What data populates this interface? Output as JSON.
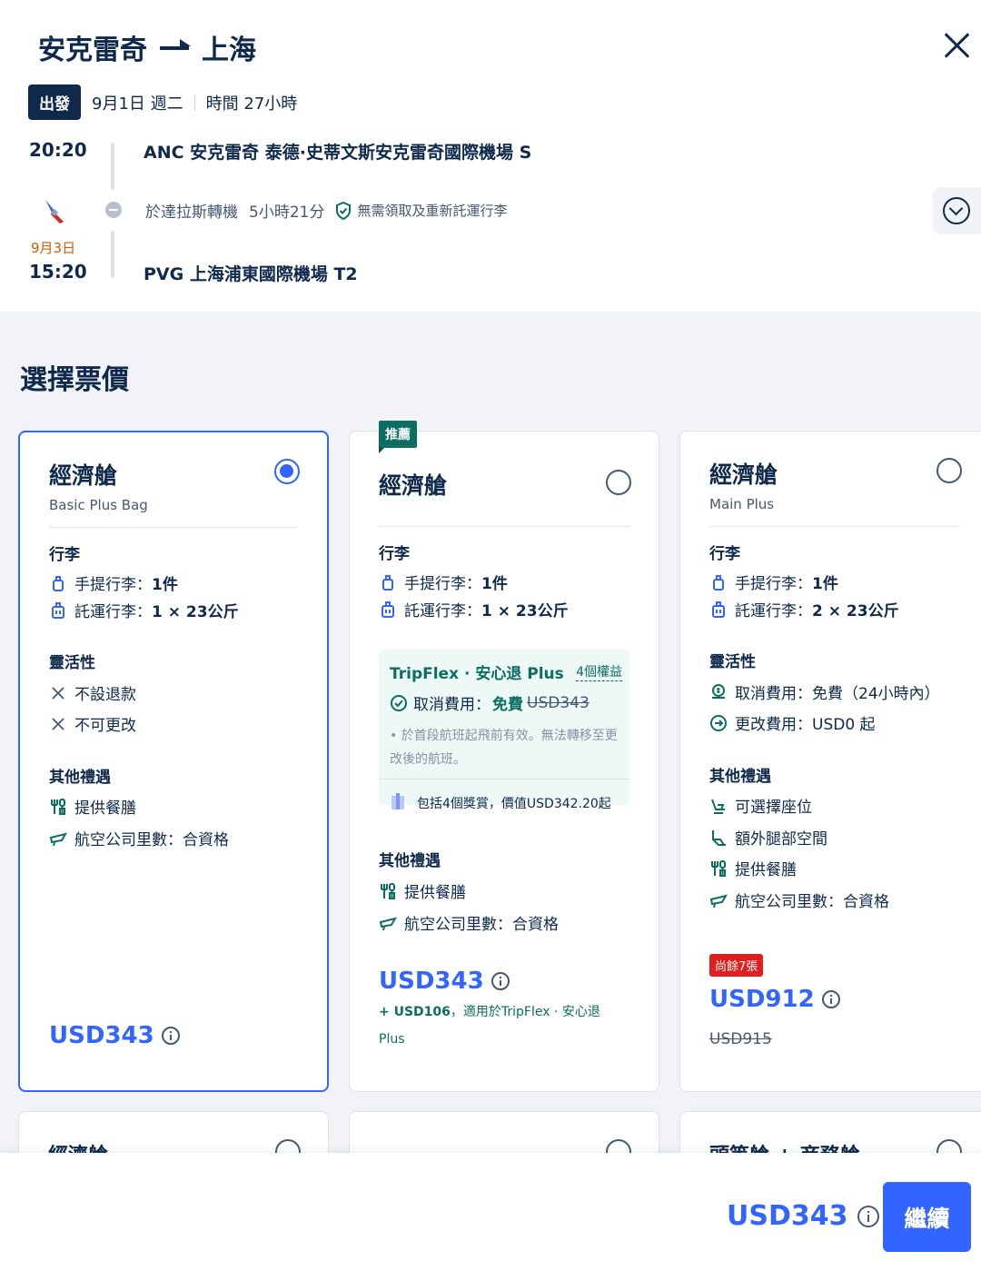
{
  "header": {
    "origin": "安克雷奇",
    "destination": "上海",
    "departure_badge": "出發",
    "date": "9月1日 週二",
    "duration": "時間 27小時",
    "dep_time": "20:20",
    "dep_airport": "ANC 安克雷奇 泰德·史蒂文斯安克雷奇國際機場 S",
    "transfer_text": "於達拉斯轉機",
    "transfer_duration": "5小時21分",
    "baggage_note": "無需領取及重新託運行李",
    "arr_nextday": "9月3日",
    "arr_time": "15:20",
    "arr_airport": "PVG 上海浦東國際機場 T2"
  },
  "section_title": "選擇票價",
  "cards": [
    {
      "class": "經濟艙",
      "fare_name": "Basic Plus Bag",
      "selected": true,
      "baggage_title": "行李",
      "carry_on_label": "手提行李：",
      "carry_on_value": "1件",
      "checked_label": "託運行李：",
      "checked_value": "1 × 23公斤",
      "flex_title": "靈活性",
      "refund": "不設退款",
      "change": "不可更改",
      "perks_title": "其他禮遇",
      "perks": [
        "提供餐膳",
        "航空公司里數：合資格"
      ],
      "price": "USD343"
    },
    {
      "badge": "推薦",
      "class": "經濟艙",
      "selected": false,
      "baggage_title": "行李",
      "carry_on_label": "手提行李：",
      "carry_on_value": "1件",
      "checked_label": "託運行李：",
      "checked_value": "1 × 23公斤",
      "tripflex_title": "TripFlex · 安心退 Plus",
      "tripflex_rights": "4個權益",
      "tripflex_cancel_label": "取消費用：",
      "tripflex_cancel_value": "免費",
      "tripflex_cancel_old": "USD343",
      "tripflex_note": "• 於首段航班起飛前有效。無法轉移至更改後的航班。",
      "tripflex_reward": "包括4個獎賞，價值USD342.20起",
      "perks_title": "其他禮遇",
      "perks": [
        "提供餐膳",
        "航空公司里數：合資格"
      ],
      "price": "USD343",
      "addon_price": "+ USD106",
      "addon_text": "，適用於TripFlex · 安心退",
      "addon_text2": "Plus"
    },
    {
      "class": "經濟艙",
      "fare_name": "Main Plus",
      "selected": false,
      "baggage_title": "行李",
      "carry_on_label": "手提行李：",
      "carry_on_value": "1件",
      "checked_label": "託運行李：",
      "checked_value": "2 × 23公斤",
      "flex_title": "靈活性",
      "refund": "取消費用：免費（24小時內）",
      "change": "更改費用：USD0 起",
      "perks_title": "其他禮遇",
      "perks": [
        "可選擇座位",
        "額外腿部空間",
        "提供餐膳",
        "航空公司里數：合資格"
      ],
      "seats_left": "尚餘7張",
      "price": "USD912",
      "old_price": "USD915"
    }
  ],
  "more_cards": [
    "經濟艙",
    "",
    "頭等艙 + 商務艙"
  ],
  "footer": {
    "total": "USD343",
    "continue_label": "繼續"
  },
  "colors": {
    "primary": "#3264ff",
    "navy": "#0f294d",
    "teal": "#0c6d63",
    "alert": "#e02020"
  }
}
